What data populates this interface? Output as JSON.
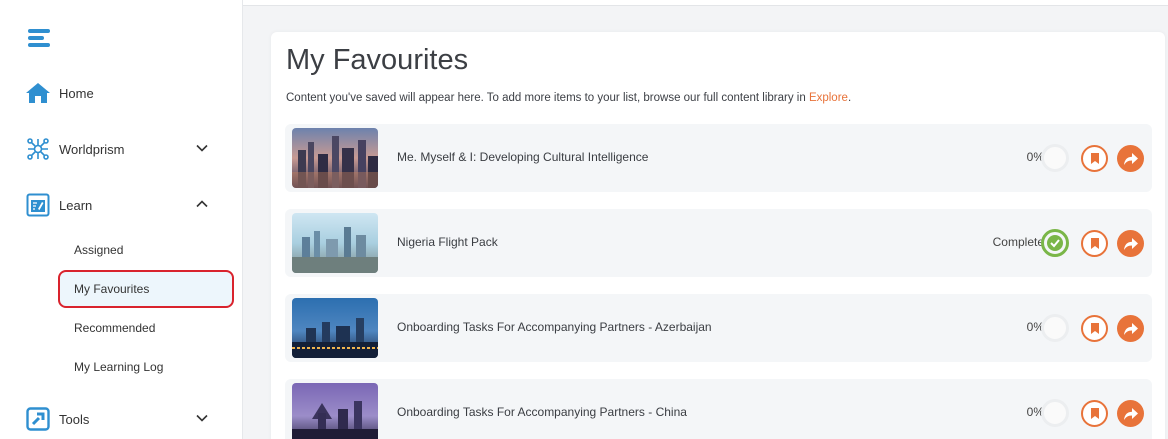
{
  "sidebar": {
    "items": [
      {
        "label": "Home",
        "icon": "home-icon"
      },
      {
        "label": "Worldprism",
        "icon": "worldprism-icon",
        "expanded": false
      },
      {
        "label": "Learn",
        "icon": "learn-icon",
        "expanded": true
      },
      {
        "label": "Tools",
        "icon": "tools-icon",
        "expanded": false
      }
    ],
    "learn_subitems": [
      {
        "label": "Assigned"
      },
      {
        "label": "My Favourites",
        "active": true
      },
      {
        "label": "Recommended"
      },
      {
        "label": "My Learning Log"
      }
    ]
  },
  "main": {
    "title": "My Favourites",
    "subtitle_text": "Content you've saved will appear here. To add more items to your list, browse our full content library in ",
    "subtitle_link": "Explore",
    "subtitle_end": ".",
    "items": [
      {
        "title": "Me. Myself & I: Developing Cultural Intelligence",
        "progress": "0%",
        "complete": false
      },
      {
        "title": "Nigeria Flight Pack",
        "progress": "Complete",
        "complete": true
      },
      {
        "title": "Onboarding Tasks For Accompanying Partners - Azerbaijan",
        "progress": "0%",
        "complete": false
      },
      {
        "title": "Onboarding Tasks For Accompanying Partners - China",
        "progress": "0%",
        "complete": false
      }
    ]
  },
  "colors": {
    "accent": "#e8733a",
    "primary_blue": "#2f8fd0",
    "complete_green": "#7ab648",
    "highlight_red": "#d9232d"
  }
}
